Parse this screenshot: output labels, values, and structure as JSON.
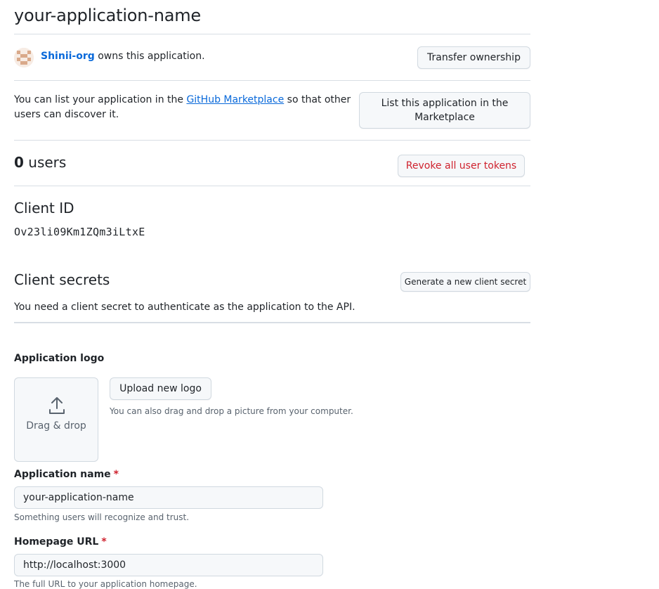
{
  "app": {
    "title": "your-application-name"
  },
  "owner": {
    "org": "Shinii-org",
    "suffix": " owns this application.",
    "transfer_button": "Transfer ownership"
  },
  "marketplace": {
    "text_before": "You can list your application in the ",
    "link": "GitHub Marketplace",
    "text_after": " so that other users can discover it.",
    "button": "List this application in the Marketplace"
  },
  "users": {
    "count": "0",
    "label": " users",
    "revoke_button": "Revoke all user tokens"
  },
  "client_id": {
    "heading": "Client ID",
    "value": "Ov23li09Km1ZQm3iLtxE"
  },
  "client_secrets": {
    "heading": "Client secrets",
    "generate_button": "Generate a new client secret",
    "description": "You need a client secret to authenticate as the application to the API."
  },
  "logo": {
    "label": "Application logo",
    "dropzone_text": "Drag & drop",
    "upload_button": "Upload new logo",
    "hint": "You can also drag and drop a picture from your computer."
  },
  "app_name": {
    "label": "Application name",
    "required": "*",
    "value": "your-application-name",
    "hint": "Something users will recognize and trust."
  },
  "homepage": {
    "label": "Homepage URL",
    "required": "*",
    "value": "http://localhost:3000",
    "hint": "The full URL to your application homepage."
  },
  "colors": {
    "link": "#0969da",
    "danger": "#cf222e",
    "border": "#d1d9e0",
    "button_bg": "#f6f8fa"
  },
  "icons": {
    "avatar": "identicon-avatar",
    "upload": "upload-icon"
  }
}
